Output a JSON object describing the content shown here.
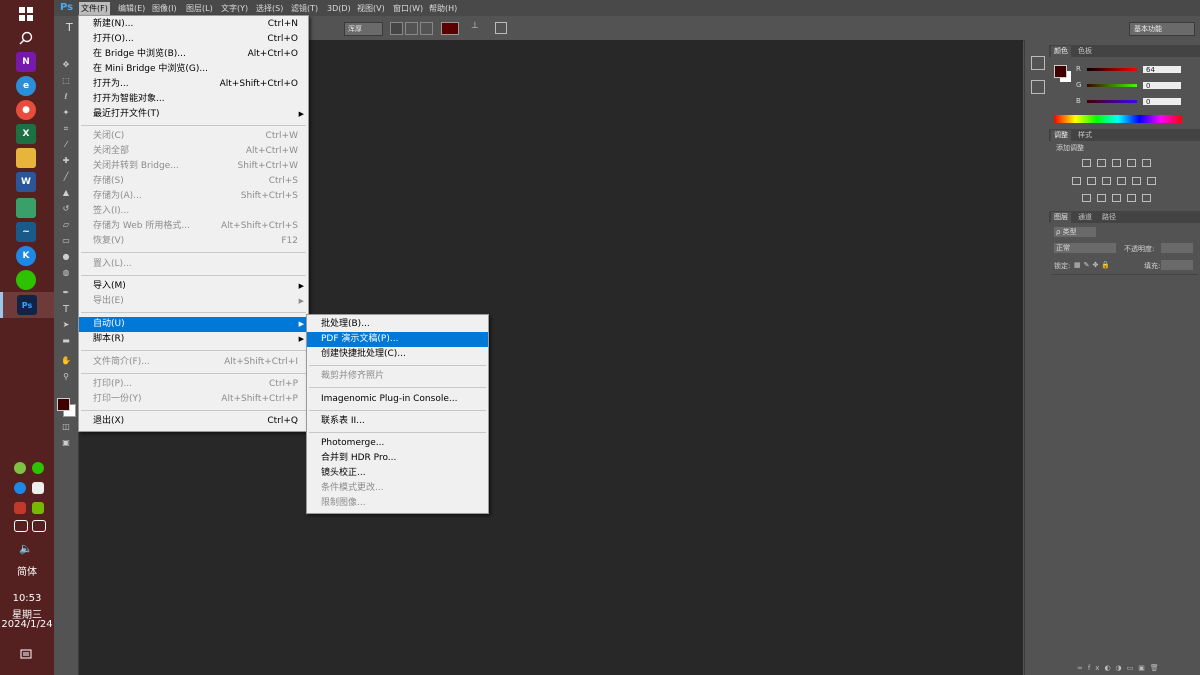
{
  "taskbar": {
    "language": "简体",
    "time": "10:53",
    "weekday": "星期三",
    "date": "2024/1/24"
  },
  "ps": {
    "logo": "Ps",
    "menubar": [
      "文件(F)",
      "编辑(E)",
      "图像(I)",
      "图层(L)",
      "文字(Y)",
      "选择(S)",
      "滤镜(T)",
      "3D(D)",
      "视图(V)",
      "窗口(W)",
      "帮助(H)"
    ],
    "options": {
      "aa_mode": "浑厚",
      "workspace": "基本功能"
    },
    "panels": {
      "color_tabs": [
        "颜色",
        "色板"
      ],
      "r_label": "R",
      "g_label": "G",
      "b_label": "B",
      "r_value": "64",
      "g_value": "0",
      "b_value": "0",
      "adj_tabs": [
        "调整",
        "样式"
      ],
      "adj_title": "添加调整",
      "layer_tabs": [
        "图层",
        "通道",
        "路径"
      ],
      "kind": "ρ 类型",
      "blend": "正常",
      "opacity_label": "不透明度:",
      "lock_label": "锁定:",
      "fill_label": "填充:"
    },
    "foreground_color": "#400000"
  },
  "file_menu": {
    "items": [
      {
        "label": "新建(N)...",
        "shortcut": "Ctrl+N"
      },
      {
        "label": "打开(O)...",
        "shortcut": "Ctrl+O"
      },
      {
        "label": "在 Bridge 中浏览(B)...",
        "shortcut": "Alt+Ctrl+O"
      },
      {
        "label": "在 Mini Bridge 中浏览(G)...",
        "shortcut": ""
      },
      {
        "label": "打开为...",
        "shortcut": "Alt+Shift+Ctrl+O"
      },
      {
        "label": "打开为智能对象...",
        "shortcut": ""
      },
      {
        "label": "最近打开文件(T)",
        "shortcut": ""
      },
      {
        "label": "关闭(C)",
        "shortcut": "Ctrl+W"
      },
      {
        "label": "关闭全部",
        "shortcut": "Alt+Ctrl+W"
      },
      {
        "label": "关闭并转到 Bridge...",
        "shortcut": "Shift+Ctrl+W"
      },
      {
        "label": "存储(S)",
        "shortcut": "Ctrl+S"
      },
      {
        "label": "存储为(A)...",
        "shortcut": "Shift+Ctrl+S"
      },
      {
        "label": "签入(I)...",
        "shortcut": ""
      },
      {
        "label": "存储为 Web 所用格式...",
        "shortcut": "Alt+Shift+Ctrl+S"
      },
      {
        "label": "恢复(V)",
        "shortcut": "F12"
      },
      {
        "label": "置入(L)...",
        "shortcut": ""
      },
      {
        "label": "导入(M)",
        "shortcut": ""
      },
      {
        "label": "导出(E)",
        "shortcut": ""
      },
      {
        "label": "自动(U)",
        "shortcut": ""
      },
      {
        "label": "脚本(R)",
        "shortcut": ""
      },
      {
        "label": "文件简介(F)...",
        "shortcut": "Alt+Shift+Ctrl+I"
      },
      {
        "label": "打印(P)...",
        "shortcut": "Ctrl+P"
      },
      {
        "label": "打印一份(Y)",
        "shortcut": "Alt+Shift+Ctrl+P"
      },
      {
        "label": "退出(X)",
        "shortcut": "Ctrl+Q"
      }
    ]
  },
  "auto_menu": {
    "items": [
      {
        "label": "批处理(B)..."
      },
      {
        "label": "PDF 演示文稿(P)..."
      },
      {
        "label": "创建快捷批处理(C)..."
      },
      {
        "label": "裁剪并修齐照片"
      },
      {
        "label": "Imagenomic Plug-in Console..."
      },
      {
        "label": "联系表 II..."
      },
      {
        "label": "Photomerge..."
      },
      {
        "label": "合并到 HDR Pro..."
      },
      {
        "label": "镜头校正..."
      },
      {
        "label": "条件模式更改..."
      },
      {
        "label": "限制图像..."
      }
    ]
  }
}
